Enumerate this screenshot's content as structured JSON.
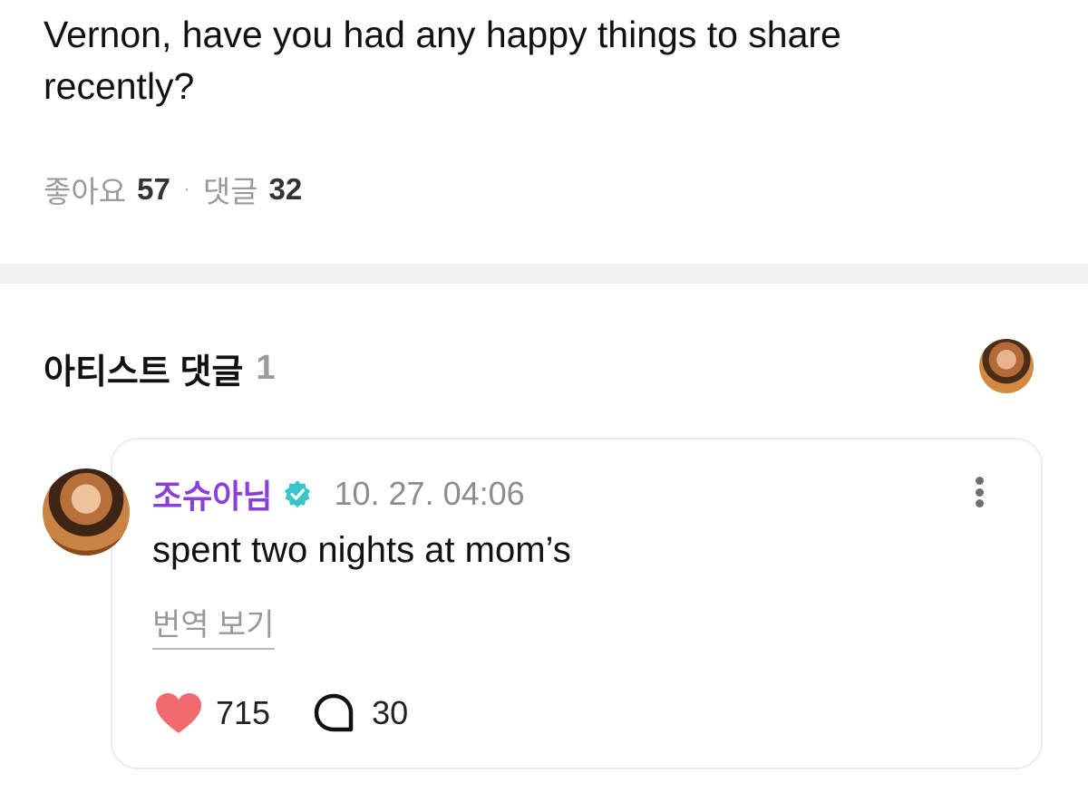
{
  "post": {
    "question": "Vernon, have you had any happy things to share recently?",
    "likes_label": "좋아요",
    "likes_count": "57",
    "separator": "·",
    "comments_label": "댓글",
    "comments_count": "32"
  },
  "artist_comments": {
    "title": "아티스트 댓글",
    "count": "1"
  },
  "comment": {
    "author": "조슈아님",
    "timestamp": "10. 27. 04:06",
    "text": "spent two nights at mom’s",
    "translate_label": "번역 보기",
    "like_count": "715",
    "reply_count": "30"
  },
  "colors": {
    "author_purple": "#8a3fd7",
    "verified_teal": "#3ac6c9",
    "heart_red": "#f26a6d"
  }
}
